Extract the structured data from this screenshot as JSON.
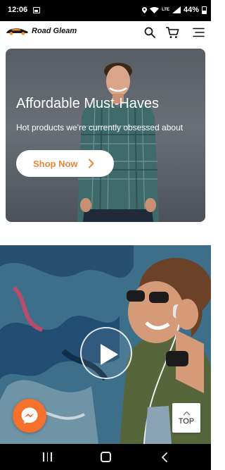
{
  "status_bar": {
    "time": "12:06",
    "network": "LTE",
    "battery": "44%",
    "icons": [
      "image-icon",
      "location-icon",
      "wifi-icon",
      "lte-icon",
      "signal-icon",
      "battery-icon"
    ]
  },
  "header": {
    "brand": "Road Gleam",
    "icons": [
      "car-logo-icon",
      "search-icon",
      "cart-icon",
      "menu-icon"
    ]
  },
  "hero": {
    "title": "Affordable Must-Haves",
    "subtitle": "Hot products we're currently obsessed about",
    "button_label": "Shop Now",
    "button_color": "#e7893b"
  },
  "video": {
    "icon": "play-icon"
  },
  "floating": {
    "messenger_icon": "messenger-icon",
    "messenger_color": "#f5702a",
    "top_label": "TOP"
  },
  "nav_bar": {
    "icons": [
      "recents-icon",
      "home-icon",
      "back-icon"
    ]
  }
}
